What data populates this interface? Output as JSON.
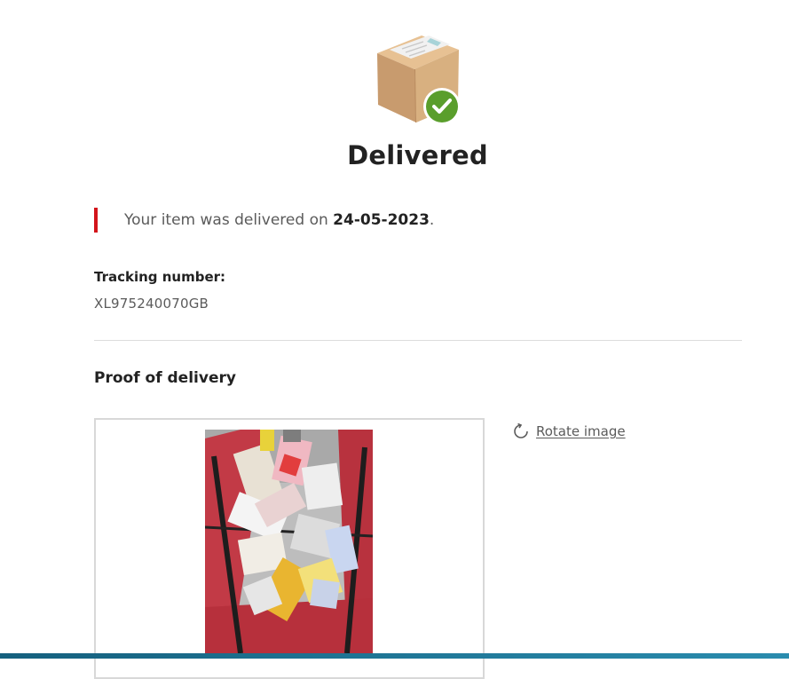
{
  "status": {
    "icon": "delivered-package-icon",
    "title": "Delivered"
  },
  "message": {
    "prefix": "Your item was delivered on ",
    "date": "24-05-2023",
    "suffix": "."
  },
  "tracking": {
    "label": "Tracking number:",
    "number": "XL975240070GB"
  },
  "proof": {
    "title": "Proof of delivery",
    "image_icon": "delivery-photo",
    "rotate_label": "Rotate image",
    "rotate_icon": "rotate-icon"
  },
  "colors": {
    "accent_red": "#d3141b",
    "success_green": "#5a9e2c",
    "text_dark": "#222222",
    "text_muted": "#5b5b5b"
  }
}
